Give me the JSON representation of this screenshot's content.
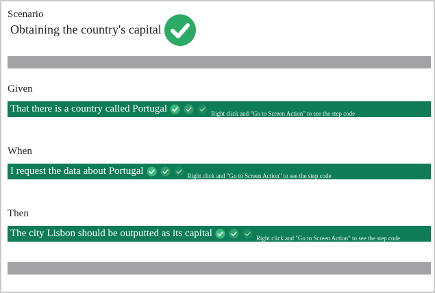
{
  "scenario": {
    "label": "Scenario",
    "title": "Obtaining the country's capital",
    "status_icon": "check-circle-icon",
    "status_color": "#2eaa67"
  },
  "colors": {
    "step_bar": "#0e7d57",
    "divider": "#a3a3a5"
  },
  "steps": [
    {
      "keyword": "Given",
      "text": "That there is a country called Portugal",
      "hint": "Right click and \"Go to Screen Action\" to see the step code"
    },
    {
      "keyword": "When",
      "text": "I request the data about Portugal",
      "hint": "Right click and \"Go to Screen Action\" to see the step code"
    },
    {
      "keyword": "Then",
      "text": "The city Lisbon should be outputted as its capital",
      "hint": "Right click and \"Go to Screen Action\" to see the step code"
    }
  ]
}
